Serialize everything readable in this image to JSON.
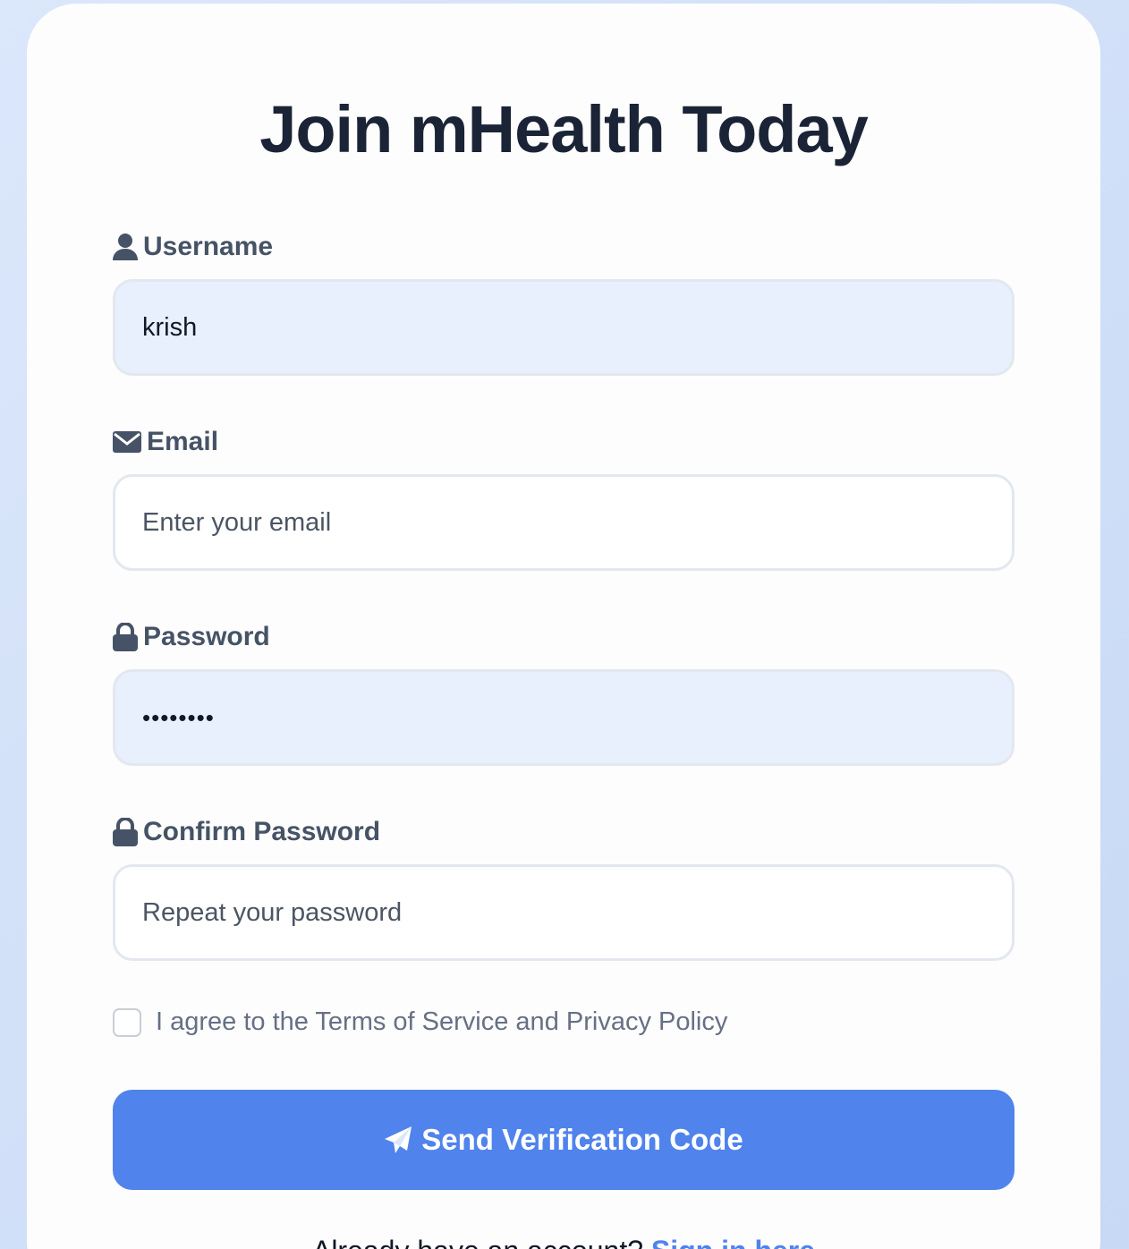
{
  "page": {
    "title": "Join mHealth Today"
  },
  "form": {
    "username": {
      "label": "Username",
      "value": "krish",
      "icon": "user-icon"
    },
    "email": {
      "label": "Email",
      "placeholder": "Enter your email",
      "value": "",
      "icon": "envelope-icon"
    },
    "password": {
      "label": "Password",
      "value": "••••••••",
      "icon": "lock-icon"
    },
    "confirm_password": {
      "label": "Confirm Password",
      "placeholder": "Repeat your password",
      "value": "",
      "icon": "lock-icon"
    },
    "terms": {
      "label": "I agree to the Terms of Service and Privacy Policy",
      "checked": false
    },
    "submit": {
      "label": "Send Verification Code",
      "icon": "paper-plane-icon"
    }
  },
  "footer": {
    "text": "Already have an account?",
    "link_label": "Sign in here"
  },
  "colors": {
    "accent": "#5083ec",
    "heading": "#1b2436",
    "label": "#465366",
    "filled_field": "#e8f0fe"
  }
}
